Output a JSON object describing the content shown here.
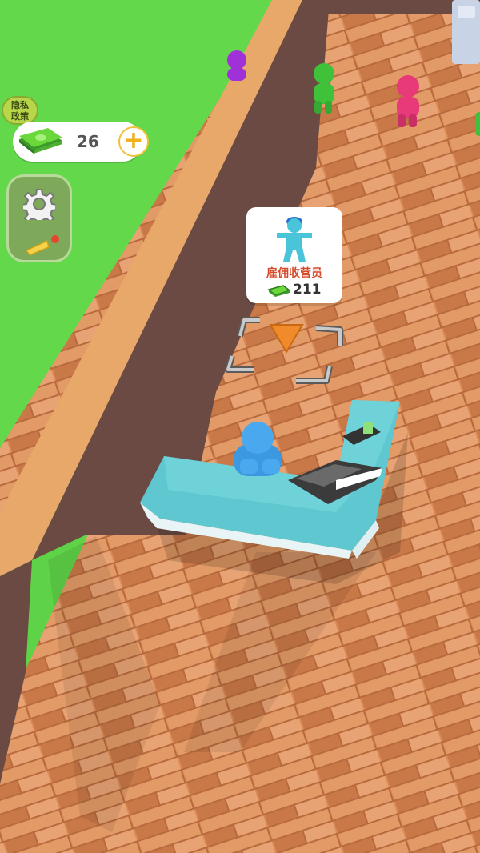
{
  "privacy": {
    "line1": "隐私",
    "line2": "政策"
  },
  "money": {
    "count": "26",
    "add_label": "+"
  },
  "hire": {
    "label": "雇佣收营员",
    "price": "211"
  },
  "icons": {
    "money": "cash-stack-icon",
    "gear": "gear-icon",
    "shovel": "shovel-icon",
    "worker": "cashier-figure-icon",
    "arrow": "down-arrow-icon"
  },
  "colors": {
    "grass": "#63d84a",
    "wall": "#6b4a44",
    "wall_top": "#e8a86a",
    "floor": "#d98a55",
    "counter": "#5ec7cf",
    "player": "#4aa8ee",
    "accent_orange": "#f08a2a",
    "price_red": "#d44a2a"
  }
}
